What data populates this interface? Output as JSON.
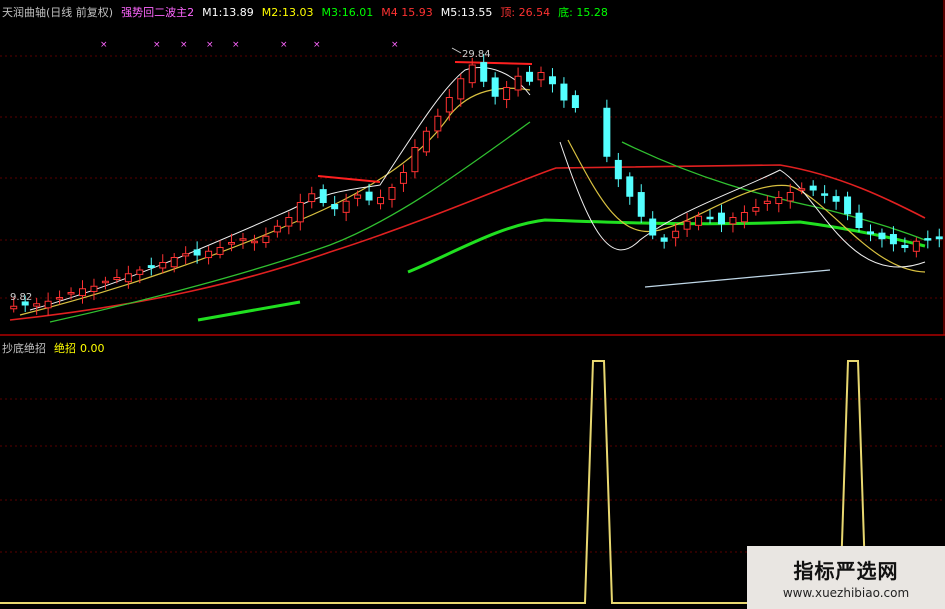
{
  "main_header": {
    "title": "天润曲轴(日线 前复权)",
    "indicator": "强势回二波主2",
    "m1_label": "M1:",
    "m1_value": "13.89",
    "m2_label": "M2:",
    "m2_value": "13.03",
    "m3_label": "M3:",
    "m3_value": "16.01",
    "m4_label": "M4",
    "m4_value": "15.93",
    "m5_label": "M5:",
    "m5_value": "13.55",
    "top_label": "顶:",
    "top_value": "26.54",
    "bottom_label": "底:",
    "bottom_value": "15.28"
  },
  "sub_header": {
    "name": "抄底绝招",
    "series_label": "绝招",
    "value": "0.00"
  },
  "annotations": {
    "high_price": "29.84",
    "low_price": "9.82"
  },
  "watermark": {
    "title": "指标严选网",
    "url": "www.xuezhibiao.com"
  },
  "colors": {
    "background": "#000000",
    "up_candle": "#ff3232",
    "down_candle": "#54ffff",
    "grid": "#7a0000",
    "m1": "#ffffff",
    "m2": "#ffff00",
    "m3": "#00ff00",
    "m4": "#ff3232",
    "m5": "#ffffff",
    "top": "#ff3232",
    "bottom": "#00ff00",
    "title": "#c0c0c0",
    "indicator": "#ff66ff",
    "signal": "#ffff66",
    "sub_name": "#c0c0c0"
  },
  "chart_data": [
    {
      "type": "candlestick",
      "title": "天润曲轴(日线 前复权)",
      "ylim": [
        8,
        32
      ],
      "close_series": [
        9.9,
        10.0,
        10.1,
        10.3,
        10.6,
        11.0,
        11.3,
        11.5,
        11.9,
        12.2,
        12.5,
        12.8,
        13.0,
        13.4,
        13.8,
        14.1,
        14.0,
        14.3,
        14.6,
        15.0,
        15.3,
        15.1,
        15.5,
        16.3,
        17.0,
        18.2,
        18.9,
        18.2,
        17.7,
        18.3,
        18.8,
        18.4,
        18.6,
        19.4,
        20.6,
        22.6,
        23.9,
        25.1,
        26.6,
        28.1,
        29.2,
        27.9,
        26.7,
        27.4,
        28.3,
        27.9,
        28.6,
        27.7,
        26.4,
        25.8,
        21.9,
        20.1,
        18.7,
        17.1,
        15.6,
        15.1,
        15.9,
        16.7,
        17.1,
        17.0,
        16.5,
        17.0,
        17.4,
        17.8,
        18.3,
        18.6,
        19.0,
        19.3,
        19.2,
        18.8,
        18.3,
        17.3,
        16.2,
        15.7,
        15.3,
        14.9,
        14.6,
        15.1,
        15.2,
        15.3
      ],
      "up_signal_marks": 8
    },
    {
      "type": "line",
      "title": "抄底绝招",
      "series": [
        {
          "name": "绝招",
          "values": [
            0,
            0,
            0,
            0,
            0,
            0,
            0,
            0,
            0,
            1,
            1,
            0,
            0,
            0,
            0,
            0,
            0,
            0,
            0,
            1,
            1,
            0,
            0
          ]
        }
      ],
      "ylim": [
        0,
        1
      ]
    }
  ]
}
